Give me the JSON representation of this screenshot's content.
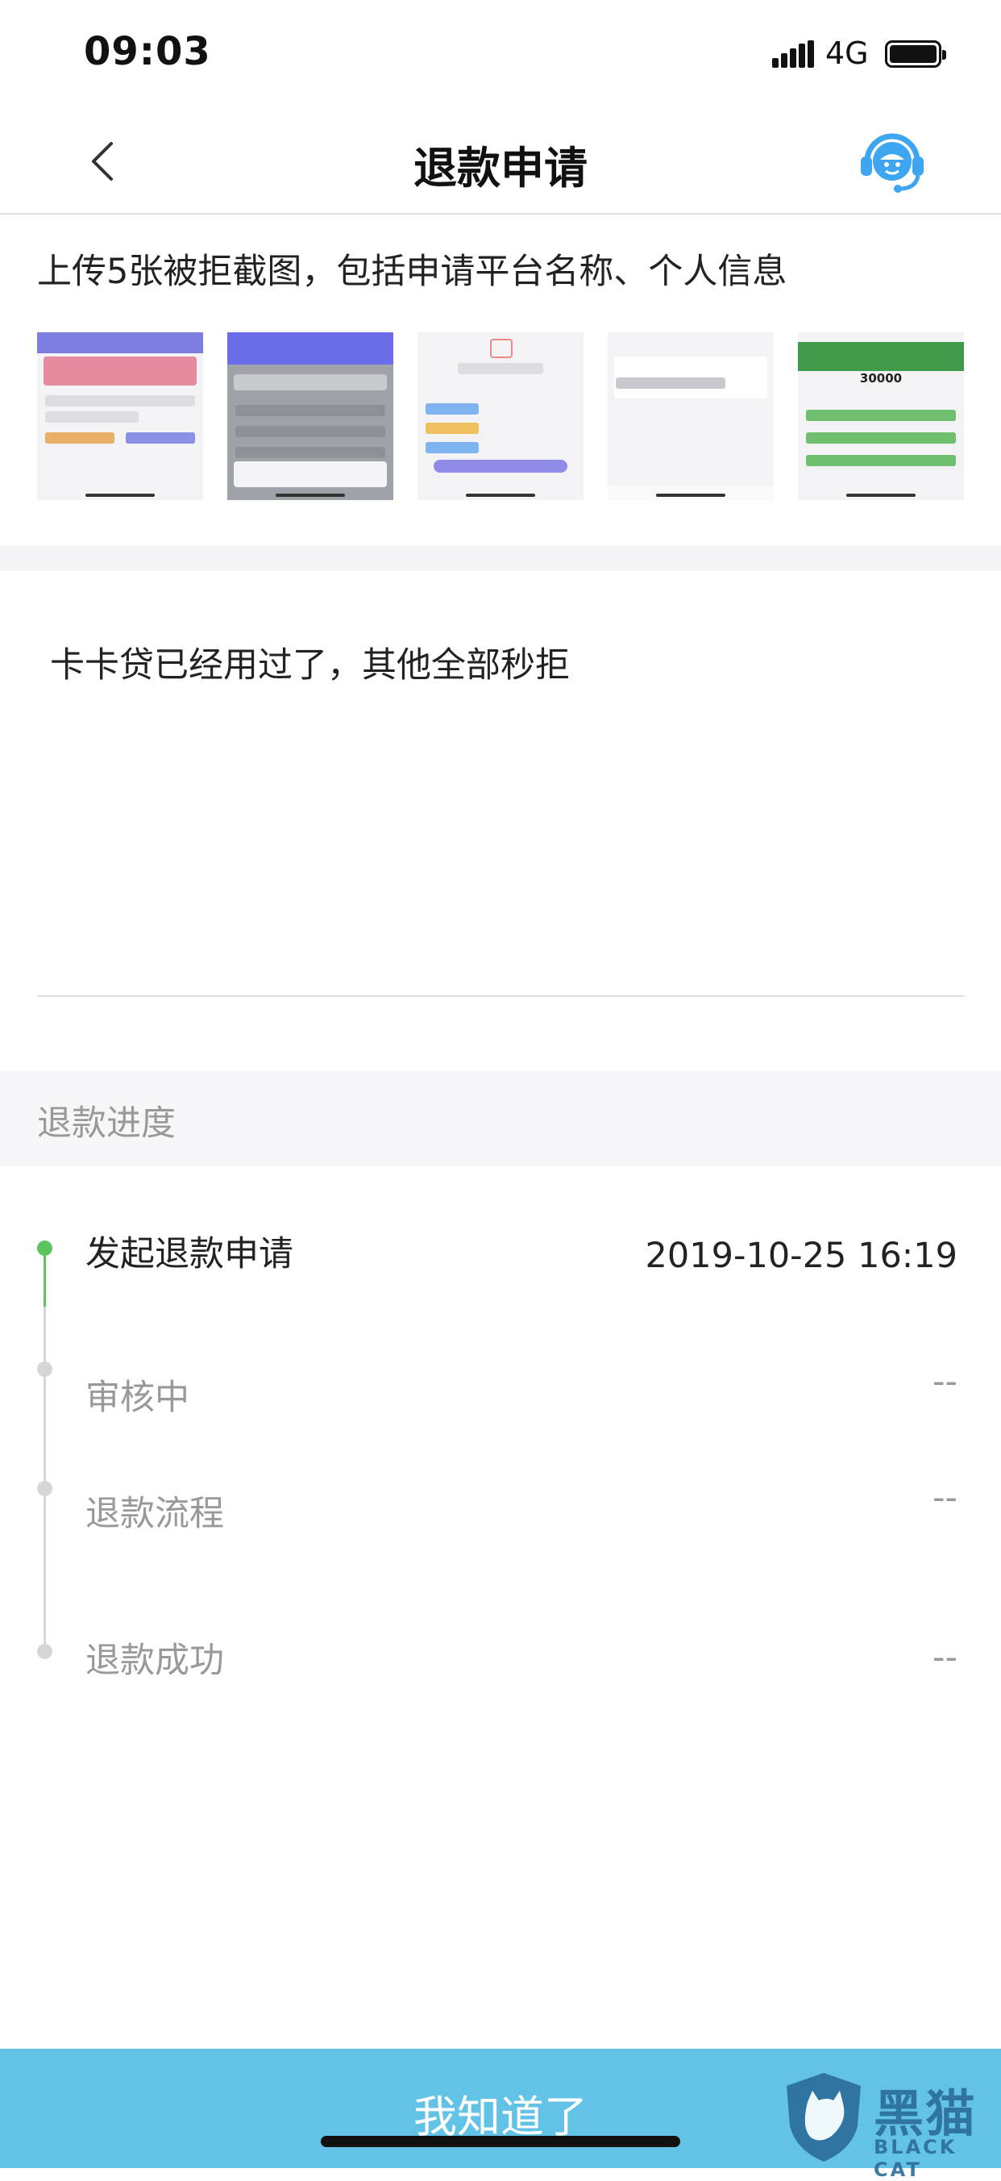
{
  "status_bar": {
    "time": "09:03",
    "network": "4G"
  },
  "nav": {
    "title": "退款申请",
    "back_icon": "chevron-left-icon",
    "service_icon": "customer-service-icon"
  },
  "upload": {
    "hint": "上传5张被拒截图，包括申请平台名称、个人信息",
    "thumbnails": [
      {
        "name": "rejection-screenshot-1",
        "amount_text": ""
      },
      {
        "name": "rejection-screenshot-2",
        "amount_text": ""
      },
      {
        "name": "rejection-screenshot-3",
        "amount_text": ""
      },
      {
        "name": "rejection-screenshot-4",
        "amount_text": ""
      },
      {
        "name": "rejection-screenshot-5",
        "amount_text": "30000"
      }
    ]
  },
  "comment": {
    "text": "卡卡贷已经用过了，其他全部秒拒"
  },
  "progress": {
    "title": "退款进度",
    "steps": [
      {
        "label": "发起退款申请",
        "time": "2019-10-25 16:19",
        "active": true
      },
      {
        "label": "审核中",
        "time": "--",
        "active": false
      },
      {
        "label": "退款流程",
        "time": "--",
        "active": false
      },
      {
        "label": "退款成功",
        "time": "--",
        "active": false
      }
    ]
  },
  "footer": {
    "button_label": "我知道了"
  },
  "watermark": {
    "cn": "黑猫",
    "en": "BLACK CAT"
  },
  "colors": {
    "accent": "#62c3e6",
    "active_step": "#5cc45f",
    "inactive_step": "#cccccc",
    "muted_text": "#999999",
    "watermark": "#2b6d9a"
  }
}
